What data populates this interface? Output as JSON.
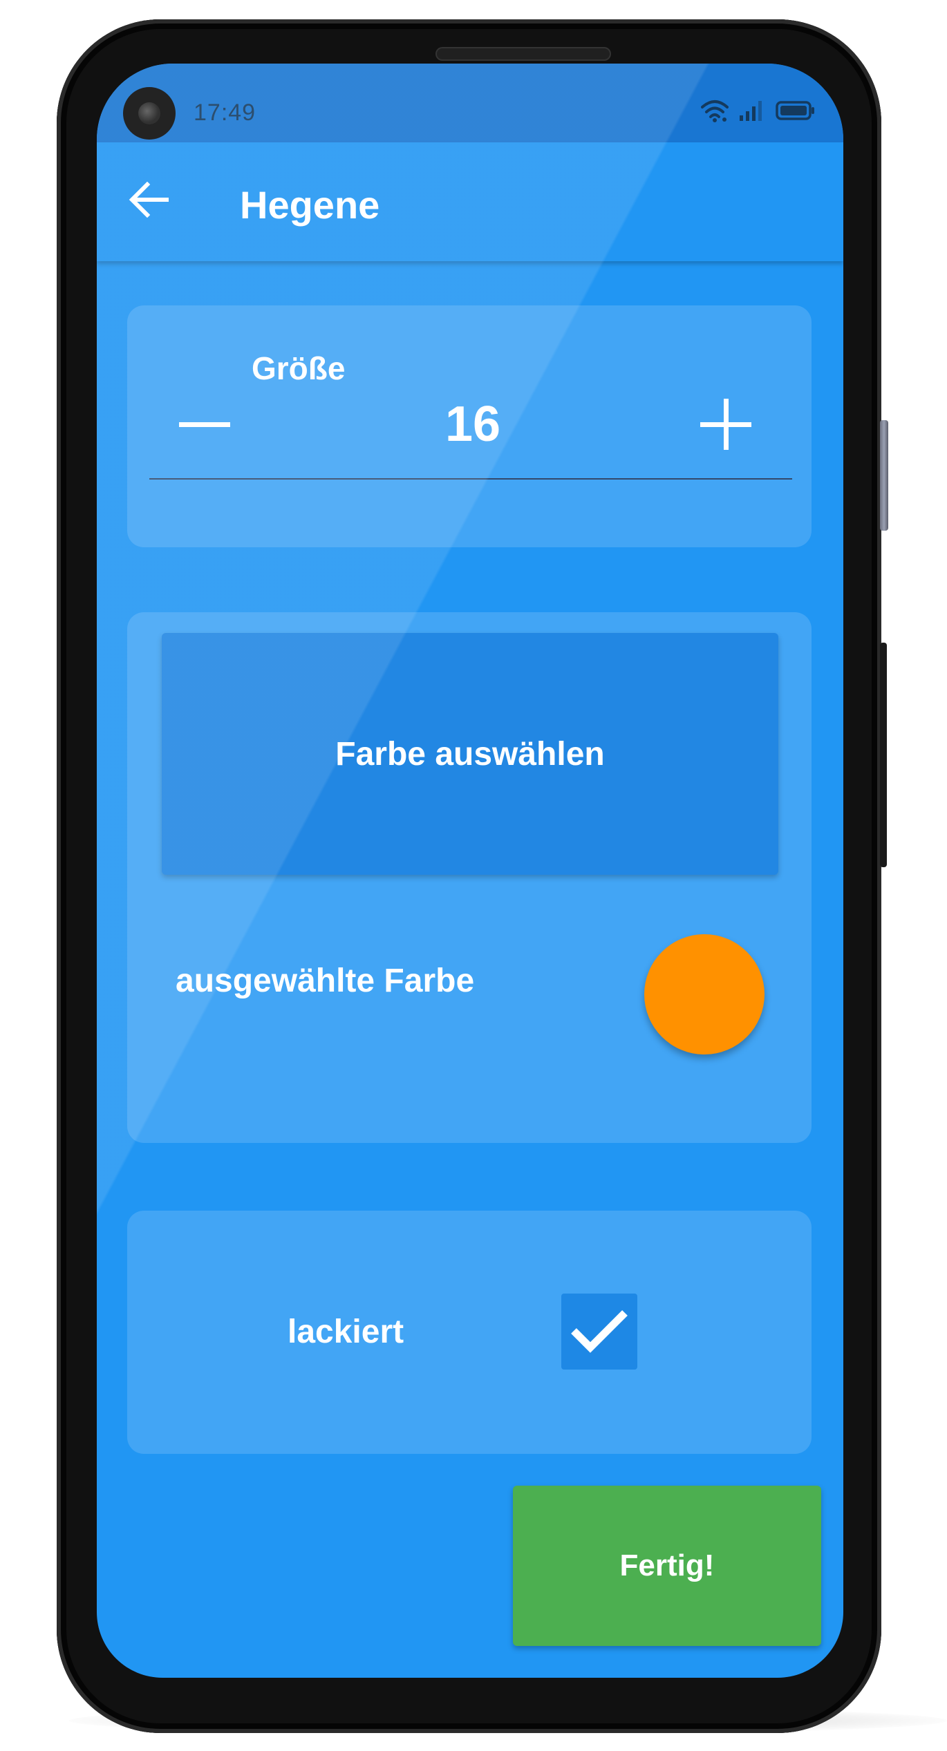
{
  "status_bar": {
    "time": "17:49",
    "icons": [
      "camera-icon",
      "wifi-icon",
      "signal-icon",
      "battery-icon"
    ]
  },
  "app_bar": {
    "title": "Hegene",
    "back_icon": "arrow-left-icon"
  },
  "size_card": {
    "label": "Größe",
    "value": "16",
    "decrement_icon": "minus-icon",
    "increment_icon": "plus-icon"
  },
  "color_card": {
    "pick_button_label": "Farbe auswählen",
    "selected_label": "ausgewählte Farbe",
    "selected_color": "#FF9100"
  },
  "lacquer_card": {
    "label": "lackiert",
    "checked": true,
    "check_icon": "checkmark-icon"
  },
  "done_button": {
    "label": "Fertig!"
  },
  "colors": {
    "primary": "#2196F3",
    "primary_dark": "#1976D2",
    "card": "#42A5F5",
    "button": "#2287E3",
    "success": "#4CAF50"
  }
}
